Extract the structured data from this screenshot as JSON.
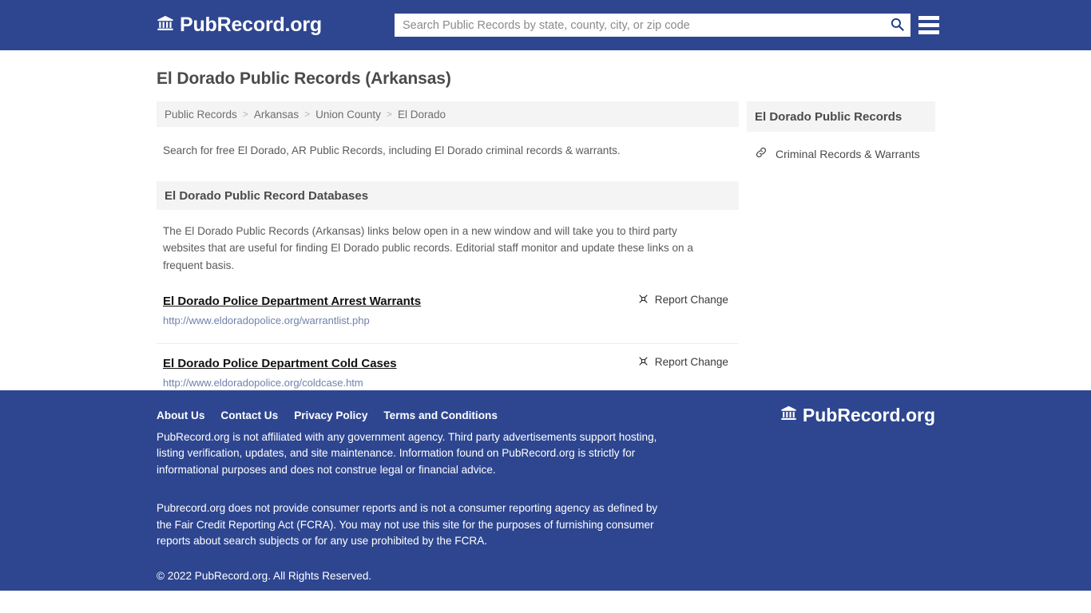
{
  "header": {
    "brand": "PubRecord.org",
    "brand_icon": "bank-building-icon",
    "search_placeholder": "Search Public Records by state, county, city, or zip code",
    "search_value": "",
    "search_icon": "search-icon",
    "menu_icon": "hamburger-menu-icon"
  },
  "main": {
    "page_title": "El Dorado Public Records (Arkansas)",
    "breadcrumb": [
      {
        "label": "Public Records",
        "current": false
      },
      {
        "label": "Arkansas",
        "current": false
      },
      {
        "label": "Union County",
        "current": false
      },
      {
        "label": "El Dorado",
        "current": true
      }
    ],
    "breadcrumb_separator": ">",
    "intro": "Search for free El Dorado, AR Public Records, including El Dorado criminal records & warrants.",
    "section_title": "El Dorado Public Record Databases",
    "section_body": "The El Dorado Public Records (Arkansas) links below open in a new window and will take you to third party websites that are useful for finding El Dorado public records. Editorial staff monitor and update these links on a frequent basis.",
    "report_change_label": "Report Change",
    "report_change_icon": "broken-link-icon",
    "databases": [
      {
        "title": "El Dorado Police Department Arrest Warrants",
        "url": "http://www.eldoradopolice.org/warrantlist.php"
      },
      {
        "title": "El Dorado Police Department Cold Cases",
        "url": "http://www.eldoradopolice.org/coldcase.htm"
      }
    ]
  },
  "sidebar": {
    "title": "El Dorado Public Records",
    "links": [
      {
        "label": "Criminal Records & Warrants",
        "icon": "link-chain-icon"
      }
    ]
  },
  "footer": {
    "nav": [
      "About Us",
      "Contact Us",
      "Privacy Policy",
      "Terms and Conditions"
    ],
    "disclaimer_1": "PubRecord.org is not affiliated with any government agency. Third party advertisements support hosting, listing verification, updates, and site maintenance. Information found on PubRecord.org is strictly for informational purposes and does not construe legal or financial advice.",
    "disclaimer_2": "Pubrecord.org does not provide consumer reports and is not a consumer reporting agency as defined by the Fair Credit Reporting Act (FCRA). You may not use this site for the purposes of furnishing consumer reports about search subjects or for any use prohibited by the FCRA.",
    "copyright": "© 2022 PubRecord.org. All Rights Reserved.",
    "brand": "PubRecord.org",
    "brand_icon": "bank-building-icon"
  },
  "colors": {
    "brand_blue": "#2e4690",
    "panel_gray": "#f4f4f4",
    "url_blue": "#7081ac"
  }
}
